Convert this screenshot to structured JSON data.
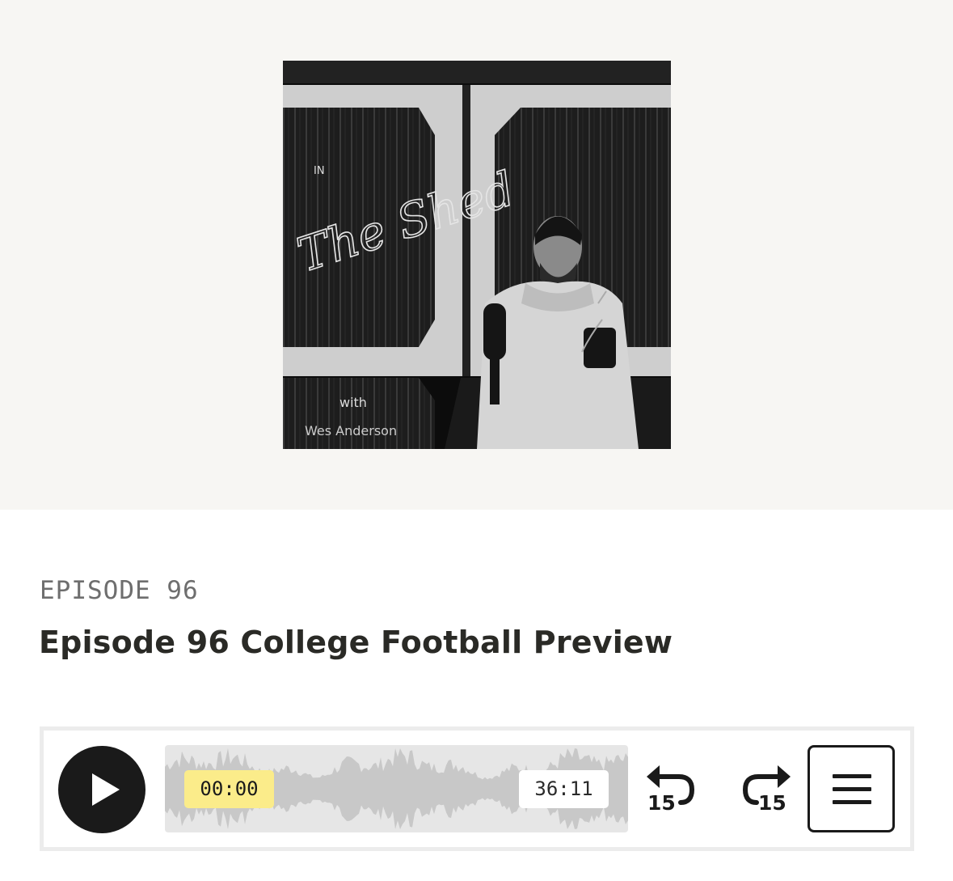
{
  "cover": {
    "title_small": "IN",
    "title_script": "The Shed",
    "with_text": "with",
    "host": "Wes Anderson"
  },
  "episode": {
    "label": "EPISODE 96",
    "title": "Episode 96 College Football Preview"
  },
  "player": {
    "current_time": "00:00",
    "total_time": "36:11",
    "skip_back_seconds": "15",
    "skip_forward_seconds": "15",
    "progress": 0
  },
  "icons": {
    "play": "play-icon",
    "skip_back": "rewind-15-icon",
    "skip_forward": "forward-15-icon",
    "menu": "hamburger-menu-icon"
  },
  "colors": {
    "hero_bg": "#f7f6f3",
    "time_highlight": "#fbec8a",
    "waveform": "#c8c8c8",
    "button_dark": "#1a1a1a"
  }
}
